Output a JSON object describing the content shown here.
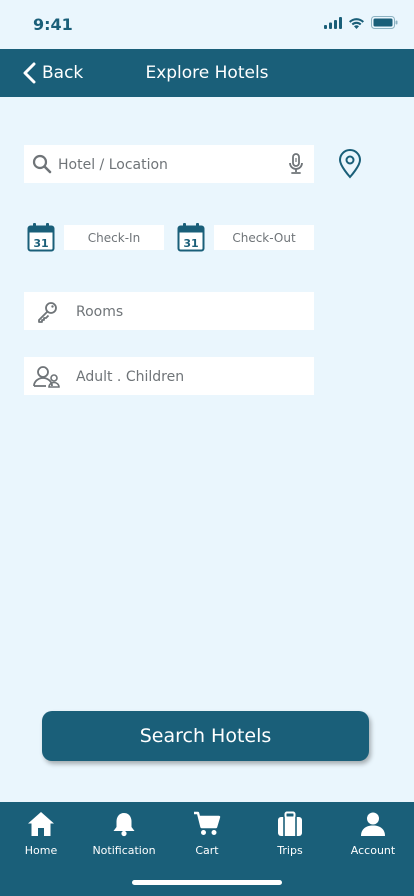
{
  "status_bar": {
    "time": "9:41"
  },
  "nav": {
    "back_label": "Back",
    "title": "Explore Hotels"
  },
  "search": {
    "placeholder": "Hotel / Location"
  },
  "dates": {
    "check_in": "Check-In",
    "check_out": "Check-Out",
    "calendar_day": "31"
  },
  "rooms": {
    "placeholder": "Rooms"
  },
  "guests": {
    "placeholder": "Adult . Children"
  },
  "search_button": {
    "label": "Search Hotels"
  },
  "tabs": [
    {
      "label": "Home",
      "icon": "home-icon"
    },
    {
      "label": "Notification",
      "icon": "bell-icon"
    },
    {
      "label": "Cart",
      "icon": "cart-icon"
    },
    {
      "label": "Trips",
      "icon": "suitcase-icon"
    },
    {
      "label": "Account",
      "icon": "person-icon"
    }
  ],
  "colors": {
    "primary": "#1a5f79",
    "background": "#eaf6fd",
    "field": "#ffffff",
    "text_muted": "#6f7478"
  }
}
